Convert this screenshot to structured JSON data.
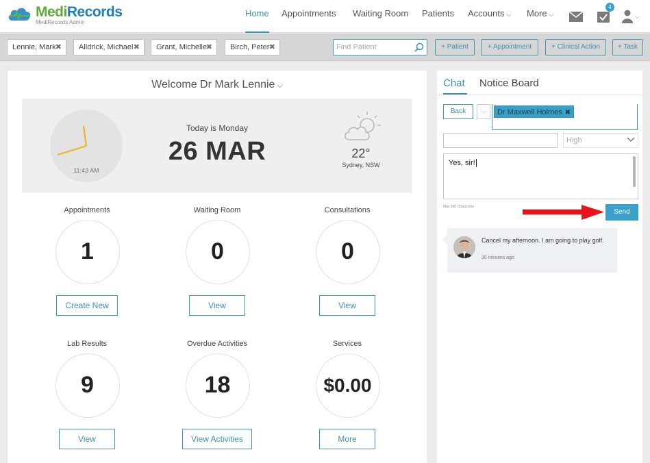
{
  "app": {
    "name_part1": "Medi",
    "name_part2": "Records",
    "subtitle": "MediRecords Admin"
  },
  "nav": {
    "items": [
      {
        "label": "Home",
        "active": true
      },
      {
        "label": "Appointments"
      },
      {
        "label": "Waiting Room"
      },
      {
        "label": "Patients"
      },
      {
        "label": "Accounts"
      },
      {
        "label": "More"
      }
    ],
    "tasks_badge": "4",
    "icons": [
      "mail-icon",
      "tasks-icon",
      "user-icon"
    ]
  },
  "patient_tabs": [
    {
      "label": "Lennie, Mark"
    },
    {
      "label": "Alldrick, Michael"
    },
    {
      "label": "Grant, Michelle"
    },
    {
      "label": "Birch, Peter"
    }
  ],
  "search": {
    "placeholder": "Find Patient"
  },
  "quick_actions": [
    "+ Patient",
    "+ Appointment",
    "+ Clinical Action",
    "+ Task"
  ],
  "dashboard": {
    "welcome": "Welcome Dr Mark Lennie",
    "clock_time": "11:43 AM",
    "today_text": "Today is Monday",
    "date": "26 MAR",
    "temperature": "22°",
    "location": "Sydney, NSW",
    "stats": [
      {
        "label": "Appointments",
        "value": "1",
        "button": "Create New"
      },
      {
        "label": "Waiting Room",
        "value": "0",
        "button": "View"
      },
      {
        "label": "Consultations",
        "value": "0",
        "button": "View"
      },
      {
        "label": "Lab Results",
        "value": "9",
        "button": "View"
      },
      {
        "label": "Overdue Activities",
        "value": "18",
        "button": "View Activities"
      },
      {
        "label": "Services",
        "value": "$0.00",
        "button": "More"
      }
    ]
  },
  "chat": {
    "tabs": [
      "Chat",
      "Notice Board"
    ],
    "back_label": "Back",
    "recipient": "Dr Maxwell Holmes",
    "subject_value": "",
    "priority_placeholder": "High",
    "message_value": "Yes, sir!",
    "max_chars": "Max 500 Characters",
    "send_label": "Send",
    "messages": [
      {
        "text": "Cancel my afternoon. I am going to play golf.",
        "time": "30 minutes ago"
      }
    ]
  },
  "colors": {
    "accent": "#3f8fb1",
    "send_button": "#3aa0c8",
    "annotation_arrow": "#e8141b",
    "logo_green": "#5fa83c",
    "logo_blue": "#1f7fb6"
  }
}
